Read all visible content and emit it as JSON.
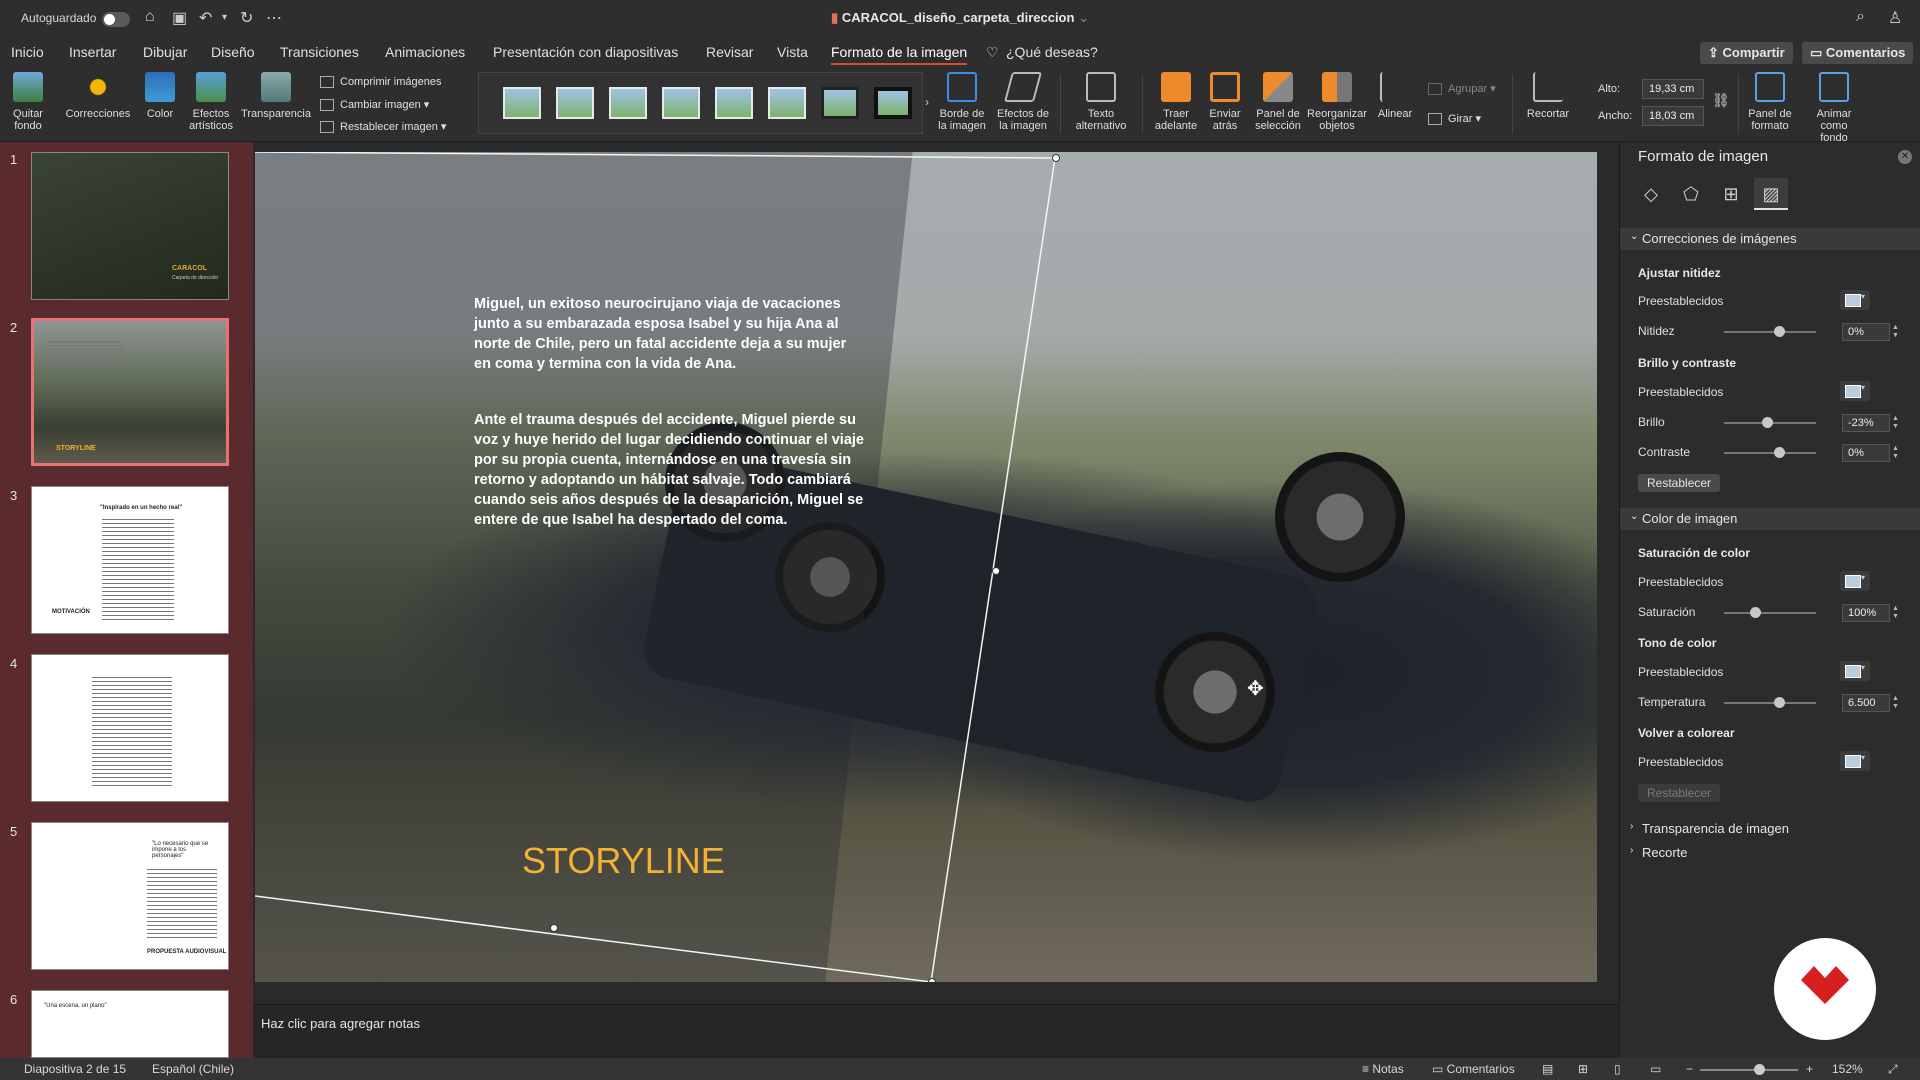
{
  "titlebar": {
    "autosave_label": "Autoguardado",
    "document_title": "CARACOL_diseño_carpeta_direccion"
  },
  "tabs": [
    "Inicio",
    "Insertar",
    "Dibujar",
    "Diseño",
    "Transiciones",
    "Animaciones",
    "Presentación con diapositivas",
    "Revisar",
    "Vista",
    "Formato de la imagen",
    "¿Qué deseas?"
  ],
  "buttons": {
    "share": "Compartir",
    "comments": "Comentarios"
  },
  "ribbon": {
    "quitar_fondo": "Quitar fondo",
    "correcciones": "Correcciones",
    "color": "Color",
    "efectos_artisticos": "Efectos artísticos",
    "transparencia": "Transparencia",
    "comprimir": "Comprimir imágenes",
    "cambiar": "Cambiar imagen",
    "restablecer": "Restablecer imagen",
    "borde": "Borde de la imagen",
    "efectos": "Efectos de la imagen",
    "texto_alt": "Texto alternativo",
    "traer": "Traer adelante",
    "enviar": "Enviar atrás",
    "panel_sel": "Panel de selección",
    "reorganizar": "Reorganizar objetos",
    "alinear": "Alinear",
    "agrupar": "Agrupar",
    "girar": "Girar",
    "recortar": "Recortar",
    "alto_label": "Alto:",
    "alto_value": "19,33 cm",
    "ancho_label": "Ancho:",
    "ancho_value": "18,03 cm",
    "panel_formato": "Panel de formato",
    "animar": "Animar como fondo"
  },
  "thumbnails": {
    "numbers": [
      "1",
      "2",
      "3",
      "4",
      "5",
      "6"
    ],
    "slide1_text": "CARACOL",
    "slide1_sub": "Carpeta de dirección",
    "slide2_text": "STORYLINE",
    "slide3_title": "\"Inspirado en un hecho real\"",
    "slide3_footer": "MOTIVACIÓN",
    "slide5_quote": "\"Lo necesario que se impone a los personajes\"",
    "slide5_footer": "PROPUESTA AUDIOVISUAL",
    "slide6_quote": "\"Una escena, un plano\""
  },
  "slide": {
    "para1": "Miguel, un exitoso neurocirujano viaja de vacaciones junto a su embarazada esposa Isabel y su hija Ana al norte de Chile, pero un fatal accidente deja a su mujer en coma y termina con la vida de Ana.",
    "para2": "Ante el trauma después del accidente, Miguel pierde su voz y huye herido del lugar decidiendo continuar el viaje por su propia cuenta, internándose en una travesía sin retorno y adoptando un hábitat salvaje. Todo cambiará cuando seis años después de la desaparición, Miguel se entere de que Isabel ha despertado del coma.",
    "title": "STORYLINE"
  },
  "panel": {
    "title": "Formato de imagen",
    "sec_correcciones": "Correcciones de imágenes",
    "ajustar_nitidez": "Ajustar nitidez",
    "preestablecidos": "Preestablecidos",
    "nitidez": "Nitidez",
    "nitidez_val": "0%",
    "brillo_contraste": "Brillo y contraste",
    "brillo": "Brillo",
    "brillo_val": "-23%",
    "contraste": "Contraste",
    "contraste_val": "0%",
    "restablecer": "Restablecer",
    "sec_color": "Color de imagen",
    "saturacion_color": "Saturación de color",
    "saturacion": "Saturación",
    "saturacion_val": "100%",
    "tono_color": "Tono de color",
    "temperatura": "Temperatura",
    "temperatura_val": "6.500",
    "volver_colorear": "Volver a colorear",
    "sec_transparencia": "Transparencia de imagen",
    "sec_recorte": "Recorte"
  },
  "notes": {
    "placeholder": "Haz clic para agregar notas"
  },
  "status": {
    "slide_info": "Diapositiva 2 de 15",
    "language": "Español (Chile)",
    "notes": "Notas",
    "comments": "Comentarios",
    "zoom": "152%"
  },
  "colors": {
    "accent": "#d14f2e",
    "storyline": "#f2b233",
    "sidebar": "#5a2a2c",
    "logo_red": "#d61f1f"
  }
}
